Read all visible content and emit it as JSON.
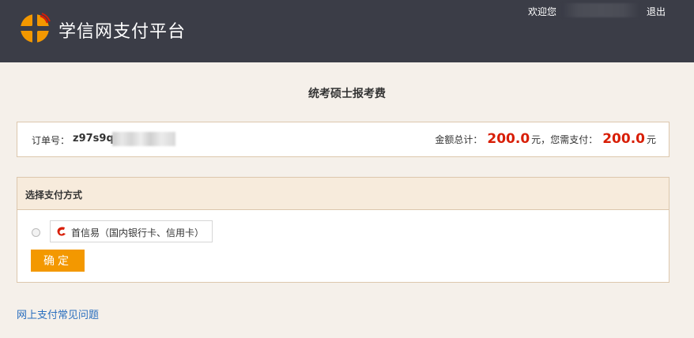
{
  "header": {
    "brand": "学信网支付平台",
    "welcome": "欢迎您",
    "logout": "退出"
  },
  "page": {
    "title": "统考硕士报考费"
  },
  "order": {
    "label": "订单号：",
    "number": "z97s9q0",
    "total_label": "金额总计：",
    "total_amount": "200.0",
    "currency_1": "元，",
    "pay_label": "您需支付：",
    "pay_amount": "200.0",
    "currency_2": "元"
  },
  "payment": {
    "heading": "选择支付方式",
    "method_label": "首信易（国内银行卡、信用卡）",
    "method_icon": "capital-payease-logo-icon",
    "confirm_label": "确定"
  },
  "footer": {
    "faq_link": "网上支付常见问题"
  },
  "colors": {
    "header_bg": "#3b3d47",
    "page_bg": "#f5f0ea",
    "amount_red": "#d81e06",
    "button_orange": "#f39800",
    "link_blue": "#2a6fbf"
  }
}
